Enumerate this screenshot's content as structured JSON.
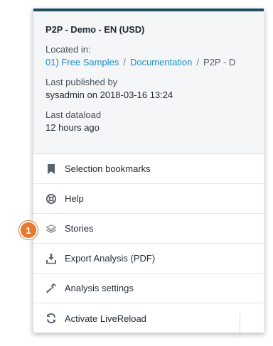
{
  "colors": {
    "accent_bar": "#1d4e5d",
    "link": "#1a8ec7",
    "badge": "#e9772d",
    "panel_header_background": "#f5f6f7"
  },
  "document": {
    "title": "P2P - Demo - EN (USD)",
    "located_label": "Located in:",
    "breadcrumb": [
      {
        "text": "01) Free Samples",
        "type": "link"
      },
      {
        "text": "/",
        "type": "separator"
      },
      {
        "text": "Documentation",
        "type": "link"
      },
      {
        "text": "/",
        "type": "separator"
      },
      {
        "text": "P2P - D",
        "type": "current"
      }
    ],
    "published_label": "Last published by",
    "published_value": "sysadmin on 2018-03-16 13:24",
    "dataload_label": "Last dataload",
    "dataload_value": "12 hours ago"
  },
  "menu": {
    "items": [
      {
        "id": "selection-bookmarks",
        "label": "Selection bookmarks",
        "icon": "bookmark-icon"
      },
      {
        "id": "help",
        "label": "Help",
        "icon": "lifebuoy-icon"
      },
      {
        "id": "stories",
        "label": "Stories",
        "icon": "stacked-layers-icon"
      },
      {
        "id": "export-analysis",
        "label": "Export Analysis (PDF)",
        "icon": "download-tray-icon"
      },
      {
        "id": "analysis-settings",
        "label": "Analysis settings",
        "icon": "wrench-icon"
      },
      {
        "id": "activate-livereload",
        "label": "Activate LiveReload",
        "icon": "refresh-icon"
      }
    ]
  },
  "callout_badge": {
    "number": "1"
  }
}
